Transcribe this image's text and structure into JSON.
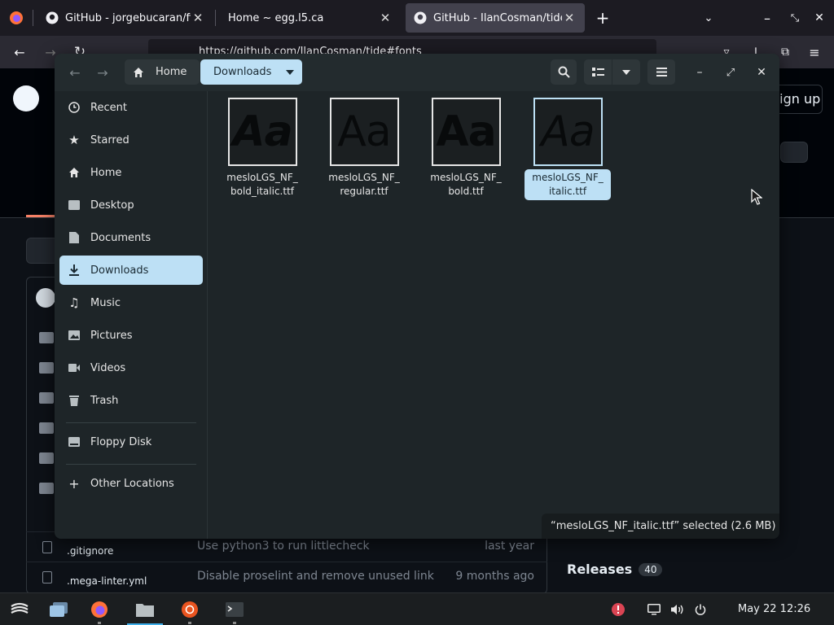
{
  "browser": {
    "tabs": [
      {
        "title": "GitHub - jorgebucaran/fish",
        "active": false
      },
      {
        "title": "Home ~ egg.l5.ca",
        "active": false
      },
      {
        "title": "GitHub - IlanCosman/tide",
        "active": true
      }
    ],
    "url": "https://github.com/IlanCosman/tide#fonts"
  },
  "github": {
    "signup_label": "Sign up",
    "files": [
      {
        "name": ".gitignore",
        "message": "Use python3 to run littlecheck",
        "date": "last year"
      },
      {
        "name": ".mega-linter.yml",
        "message": "Disable proselint and remove unused link",
        "date": "9 months ago"
      }
    ],
    "releases_label": "Releases",
    "releases_count": "40"
  },
  "dialog": {
    "breadcrumb": {
      "home": "Home",
      "current": "Downloads"
    },
    "sidebar": [
      {
        "label": "Recent",
        "icon": "clock-icon"
      },
      {
        "label": "Starred",
        "icon": "star-icon"
      },
      {
        "label": "Home",
        "icon": "home-icon"
      },
      {
        "label": "Desktop",
        "icon": "desktop-icon"
      },
      {
        "label": "Documents",
        "icon": "document-icon"
      },
      {
        "label": "Downloads",
        "icon": "download-icon",
        "selected": true
      },
      {
        "label": "Music",
        "icon": "music-icon"
      },
      {
        "label": "Pictures",
        "icon": "picture-icon"
      },
      {
        "label": "Videos",
        "icon": "video-icon"
      },
      {
        "label": "Trash",
        "icon": "trash-icon"
      },
      {
        "label": "Floppy Disk",
        "icon": "disk-icon"
      },
      {
        "label": "Other Locations",
        "icon": "plus-icon"
      }
    ],
    "files": [
      {
        "line1": "mesloLGS_NF_",
        "line2": "bold_italic.ttf",
        "preview": "Aa",
        "style": "bold italic"
      },
      {
        "line1": "mesloLGS_NF_",
        "line2": "regular.ttf",
        "preview": "Aa",
        "style": "regular"
      },
      {
        "line1": "mesloLGS_NF_",
        "line2": "bold.ttf",
        "preview": "Aa",
        "style": "bold"
      },
      {
        "line1": "mesloLGS_NF_",
        "line2": "italic.ttf",
        "preview": "Aa",
        "style": "italic",
        "selected": true
      }
    ],
    "status": "“mesloLGS_NF_italic.ttf” selected  (2.6 MB)"
  },
  "taskbar": {
    "clock": "May 22  12:26"
  },
  "colors": {
    "accent_selection": "#bde0f5",
    "dialog_bg": "#1e2528",
    "taskbar_accent": "#3daee9"
  }
}
